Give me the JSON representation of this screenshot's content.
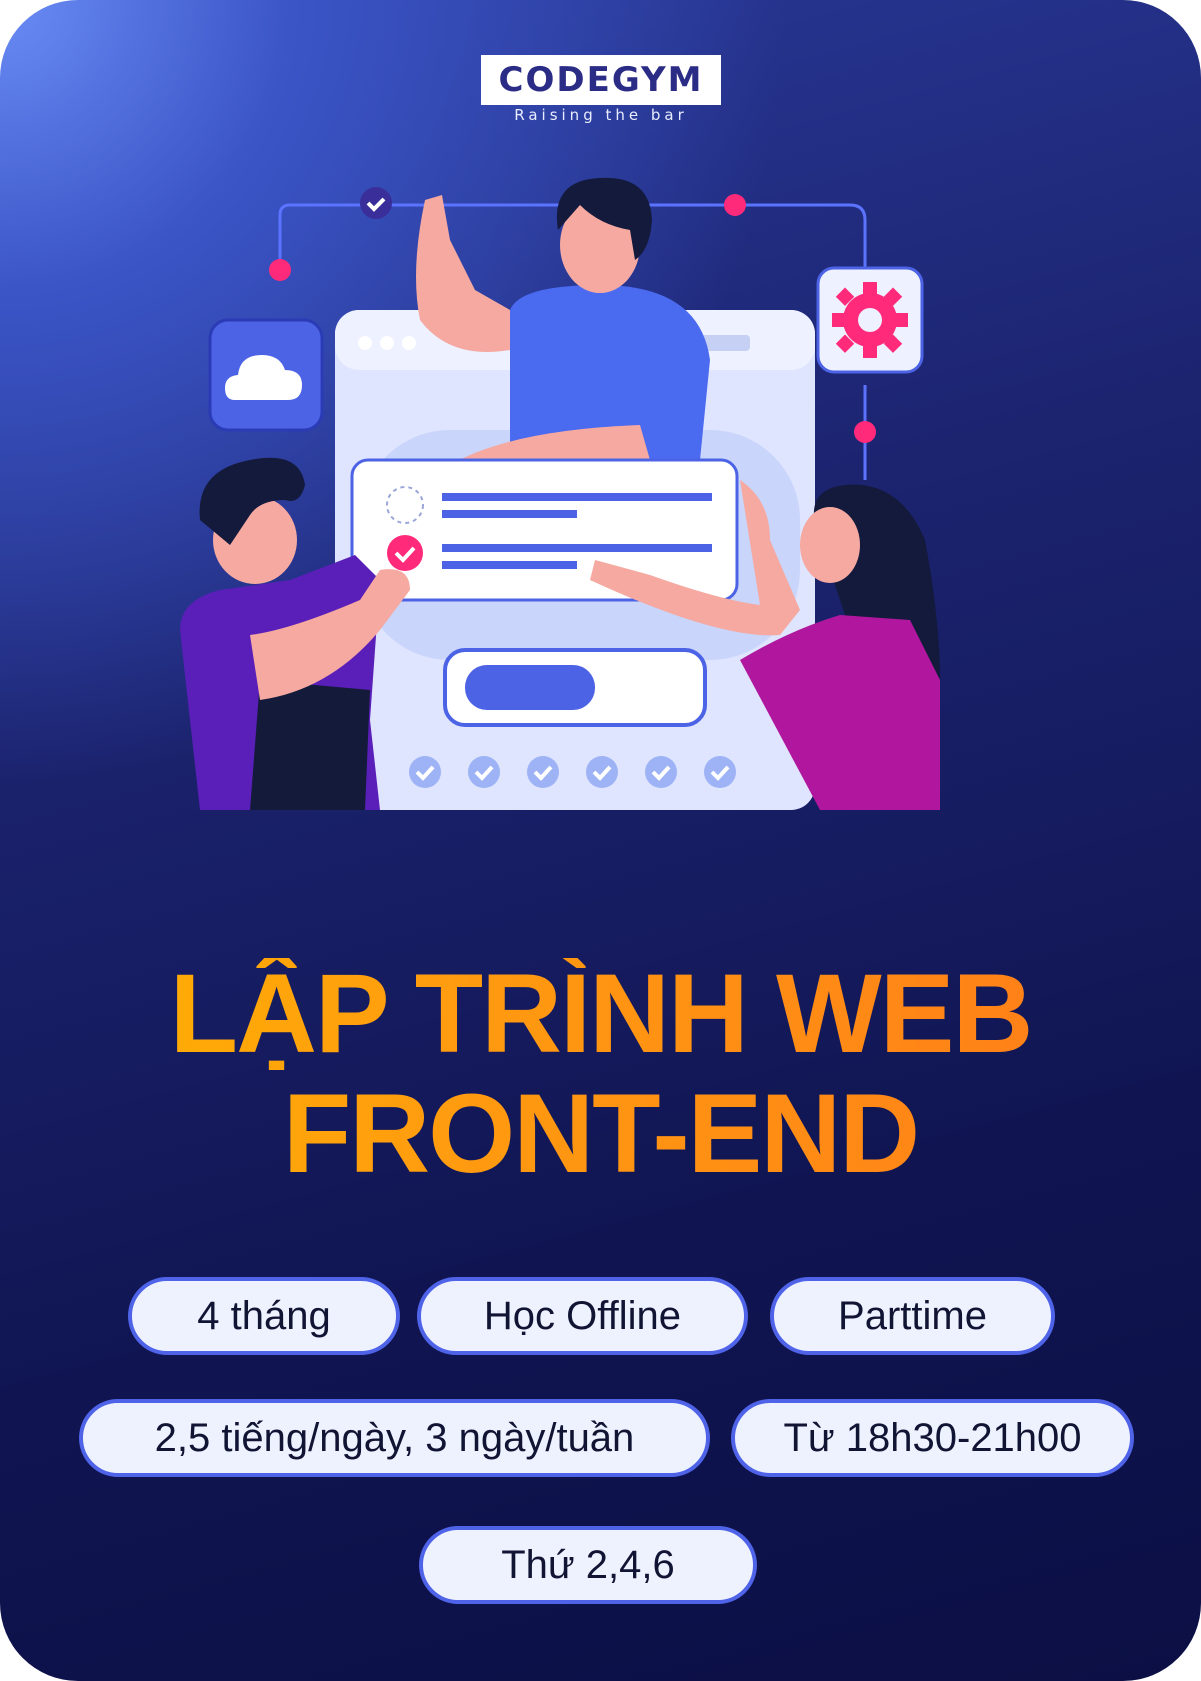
{
  "brand": {
    "logo_text": "CODEGYM",
    "tagline": "Raising the bar"
  },
  "title": {
    "line1": "LẬP TRÌNH WEB",
    "line2": "FRONT-END"
  },
  "info_pills": [
    {
      "label": "4 tháng"
    },
    {
      "label": "Học Offline"
    },
    {
      "label": "Parttime"
    },
    {
      "label": "2,5 tiếng/ngày, 3 ngày/tuần"
    },
    {
      "label": "Từ 18h30-21h00"
    },
    {
      "label": "Thứ 2,4,6"
    }
  ],
  "colors": {
    "background_dark": "#0b0f44",
    "background_light": "#3b55c7",
    "title_orange": "#ff8c12",
    "title_yellow": "#ffb300",
    "pill_fill": "#eef2ff",
    "pill_border": "#4f63e8"
  },
  "icons": [
    "cloud-icon",
    "gear-icon",
    "check-icon"
  ]
}
